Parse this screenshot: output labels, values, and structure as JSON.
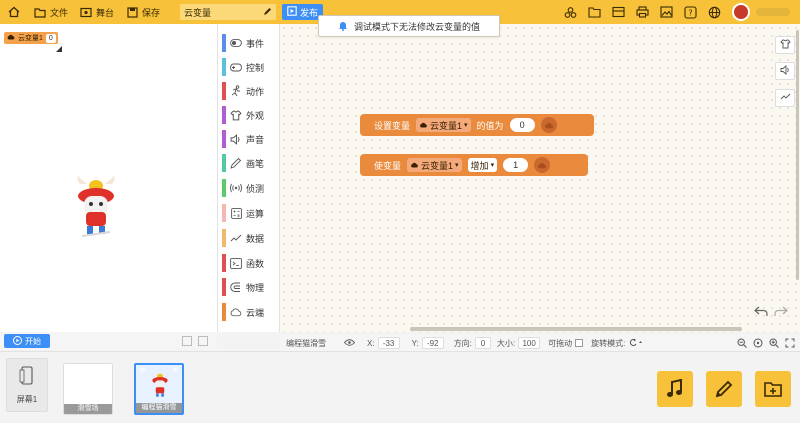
{
  "toolbar": {
    "file_label": "文件",
    "stage_label": "舞台",
    "save_label": "保存",
    "project_name": "云变量",
    "publish_label": "发布",
    "right_icons": [
      "team-icon",
      "folder-icon",
      "library-icon",
      "print-icon",
      "image-icon",
      "help-icon",
      "globe-icon"
    ]
  },
  "stage": {
    "variable_monitor": {
      "name": "云变量1",
      "value": "0"
    },
    "start_label": "开始"
  },
  "categories": [
    {
      "label": "事件",
      "color": "#5b8def",
      "icon": "toggle-icon"
    },
    {
      "label": "控制",
      "color": "#5bc0de",
      "icon": "gamepad-icon"
    },
    {
      "label": "动作",
      "color": "#e05050",
      "icon": "run-icon"
    },
    {
      "label": "外观",
      "color": "#b45bd6",
      "icon": "shirt-icon"
    },
    {
      "label": "声音",
      "color": "#b45bd6",
      "icon": "speaker-icon"
    },
    {
      "label": "画笔",
      "color": "#52c9a5",
      "icon": "pen-icon"
    },
    {
      "label": "侦测",
      "color": "#5ec96b",
      "icon": "signal-icon"
    },
    {
      "label": "运算",
      "color": "#f4b8b0",
      "icon": "calc-icon"
    },
    {
      "label": "数据",
      "color": "#f3b870",
      "icon": "chart-icon"
    },
    {
      "label": "函数",
      "color": "#e05050",
      "icon": "function-icon"
    },
    {
      "label": "物理",
      "color": "#e05050",
      "icon": "magnet-icon"
    },
    {
      "label": "云端",
      "color": "#e98a3c",
      "icon": "cloud-icon"
    }
  ],
  "workspace": {
    "banner": "调试模式下无法修改云变量的值",
    "blocks": [
      {
        "prefix": "设置变量",
        "variable": "云变量1",
        "middle": "的值为",
        "value": "0"
      },
      {
        "prefix": "使变量",
        "variable": "云变量1",
        "operation": "增加",
        "value": "1"
      }
    ]
  },
  "properties": {
    "sprite_name": "编程猫滑雪",
    "x_label": "X:",
    "x": "-33",
    "y_label": "Y:",
    "y": "-92",
    "direction_label": "方向:",
    "direction": "0",
    "size_label": "大小:",
    "size": "100",
    "draggable_label": "可拖动",
    "rotation_label": "旋转模式:"
  },
  "assets": {
    "screen_label": "屏幕1",
    "items": [
      {
        "name": "滑雪场",
        "selected": false
      },
      {
        "name": "编程猫滑雪",
        "selected": true
      }
    ]
  },
  "colors": {
    "toolbar": "#f7c23a",
    "accent": "#3d8ff6",
    "cloud_block": "#e98a3c"
  }
}
